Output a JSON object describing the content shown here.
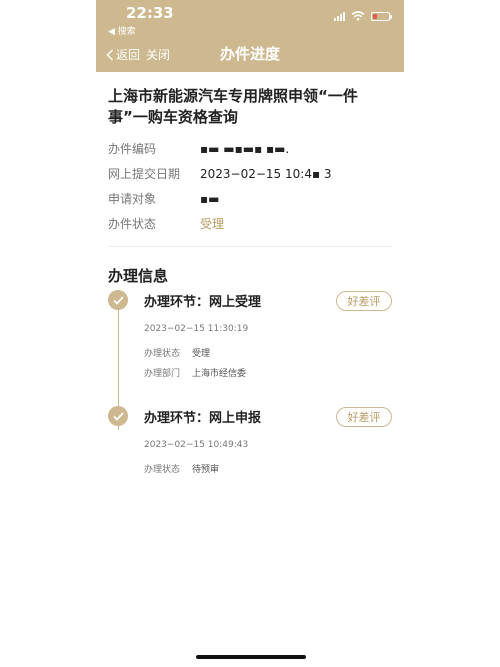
{
  "status": {
    "time": "22:33",
    "back_app": "◀ 搜索"
  },
  "nav": {
    "back_label": "返回",
    "close_label": "关闭",
    "title": "办件进度"
  },
  "item": {
    "title": "上海市新能源汽车专用牌照申领“一件事”一购车资格查询",
    "rows": [
      {
        "label": "办件编码",
        "value": "▪▬  ▬▪▬▪ ▪▬."
      },
      {
        "label": "网上提交日期",
        "value": "2023−02−15 10:4▪ 3"
      },
      {
        "label": "申请对象",
        "value": "▪▬"
      },
      {
        "label": "办件状态",
        "value": "受理"
      }
    ]
  },
  "section_title": "办理信息",
  "steps": [
    {
      "title": "办理环节：网上受理",
      "rate_label": "好差评",
      "time": "2023−02−15 11:30:19",
      "meta": [
        {
          "label": "办理状态",
          "value": "受理"
        },
        {
          "label": "办理部门",
          "value": "上海市经信委"
        }
      ]
    },
    {
      "title": "办理环节：网上申报",
      "rate_label": "好差评",
      "time": "2023−02−15 10:49:43",
      "meta": [
        {
          "label": "办理状态",
          "value": "待预审"
        }
      ]
    }
  ],
  "colors": {
    "header": "#cdb88f",
    "accent": "#b89a62"
  }
}
